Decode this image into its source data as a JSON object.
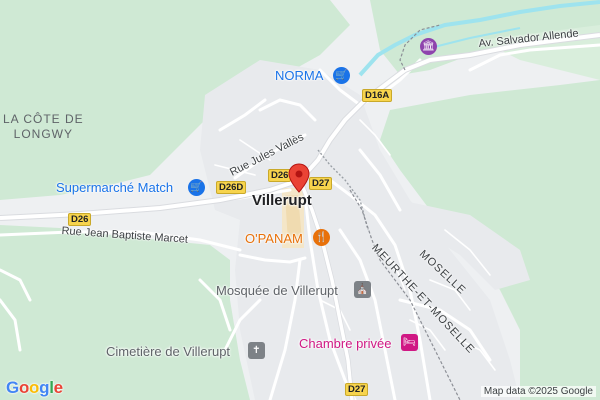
{
  "map": {
    "town_name": "Villerupt",
    "district_label": "LA CÔTE DE\nLONGWY",
    "region_labels": {
      "moselle": "MOSELLE",
      "meurthe_et_moselle": "MEURTHE-ET-MOSELLE"
    },
    "streets": {
      "jules_valles": "Rue Jules Vallès",
      "jean_baptiste_marcet": "Rue Jean Baptiste Marcet",
      "salvador_allende": "Av. Salvador Allende"
    },
    "road_shields": {
      "d16a": "D16A",
      "d26_left": "D26",
      "d26d": "D26D",
      "d26_center": "D26",
      "d27_center": "D27",
      "d27_bottom": "D27"
    },
    "pois": [
      {
        "id": "norma",
        "label": "NORMA",
        "icon": "shopping-cart-icon",
        "color": "#1a73e8"
      },
      {
        "id": "supermarche-match",
        "label": "Supermarché Match",
        "icon": "shopping-cart-icon",
        "color": "#1a73e8"
      },
      {
        "id": "opanam",
        "label": "O'PANAM",
        "icon": "restaurant-icon",
        "color": "#e8710a"
      },
      {
        "id": "mosquee",
        "label": "Mosquée de Villerupt",
        "icon": "worship-icon",
        "color": "#5f6368"
      },
      {
        "id": "cimetiere",
        "label": "Cimetière de Villerupt",
        "icon": "cemetery-icon",
        "color": "#5f6368"
      },
      {
        "id": "chambre-privee",
        "label": "Chambre privée",
        "icon": "bed-icon",
        "color": "#d01884"
      }
    ],
    "marker": {
      "icon": "location-pin-icon",
      "color": "#ea4335"
    },
    "top_right_icon": {
      "icon": "building-icon",
      "color": "#8e44ad"
    }
  },
  "branding": {
    "logo_text": "Google",
    "logo_colors": [
      "#4285f4",
      "#ea4335",
      "#fbbc05",
      "#4285f4",
      "#34a853",
      "#ea4335"
    ],
    "attribution": "Map data ©2025 Google"
  }
}
